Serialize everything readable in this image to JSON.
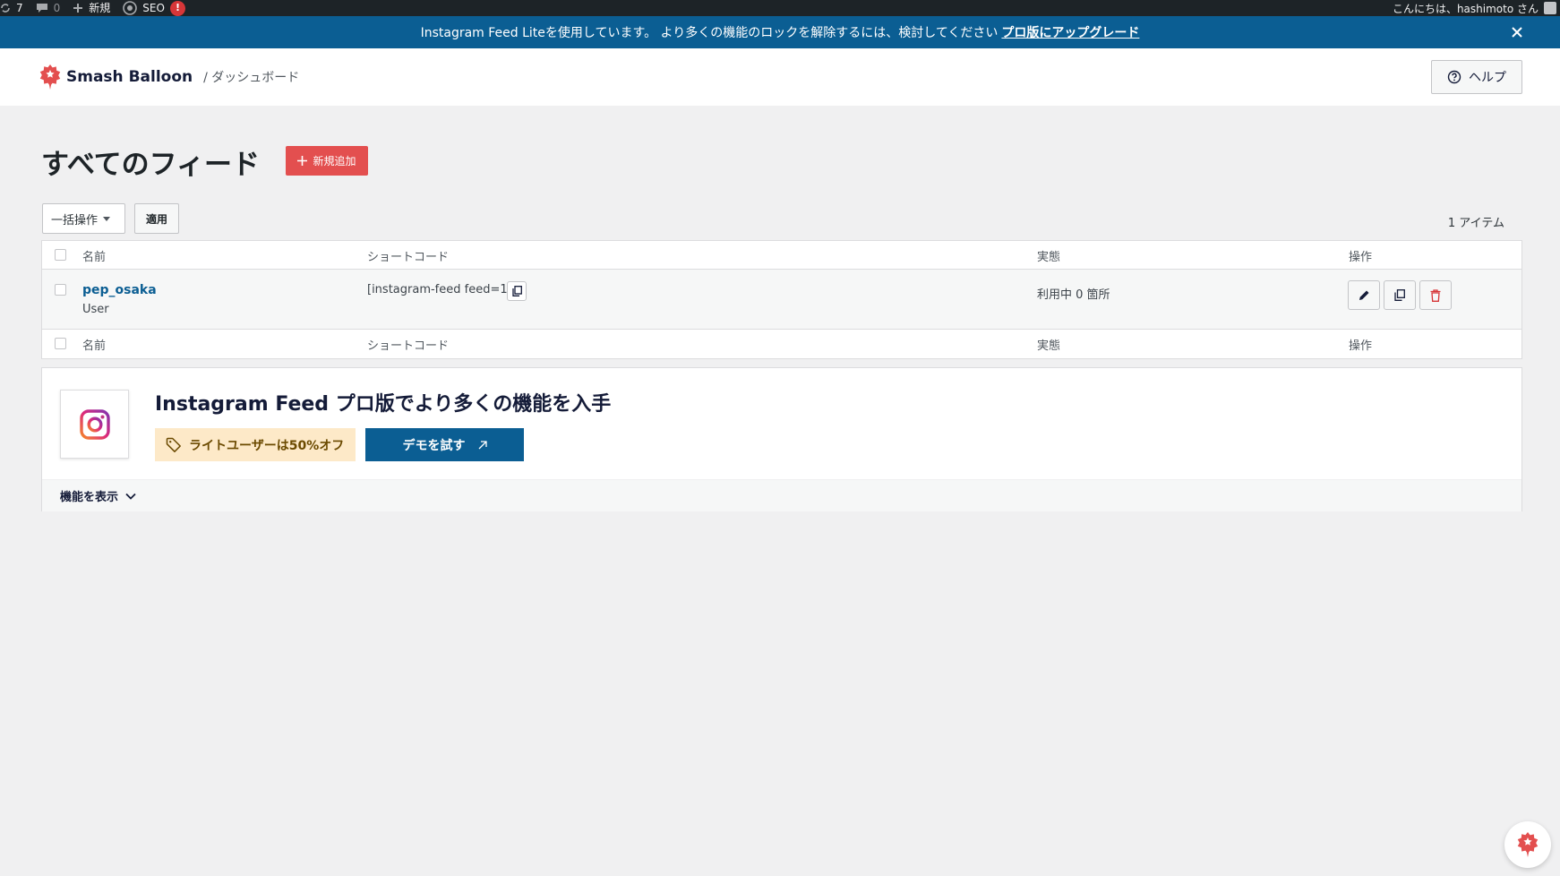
{
  "admin_bar": {
    "updates_count": "7",
    "comments_count": "0",
    "new_label": "新規",
    "seo_label": "SEO",
    "seo_badge": "!",
    "greeting": "こんにちは、hashimoto さん"
  },
  "notice": {
    "text": "Instagram Feed Liteを使用しています。 より多くの機能のロックを解除するには、検討してください",
    "link": "プロ版にアップグレード"
  },
  "header": {
    "brand": "Smash Balloon",
    "breadcrumb": "/ ダッシュボード",
    "help_label": "ヘルプ"
  },
  "page": {
    "title": "すべてのフィード",
    "add_new_label": "新規追加"
  },
  "bulk": {
    "select_label": "一括操作",
    "apply_label": "適用",
    "item_count": "1 アイテム"
  },
  "table": {
    "columns": [
      "名前",
      "ショートコード",
      "実態",
      "操作"
    ],
    "rows": [
      {
        "name": "pep_osaka",
        "type": "User",
        "shortcode": "[instagram-feed feed=1]",
        "status": "利用中 0 箇所"
      }
    ]
  },
  "promo": {
    "title": "Instagram Feed プロ版でより多くの機能を入手",
    "discount_label": "ライトユーザーは50%オフ",
    "demo_label": "デモを試す",
    "features_label": "機能を表示"
  },
  "colors": {
    "admin_bar": "#1d2327",
    "notice": "#0b5e93",
    "accent_red": "#e34f4f",
    "link_blue": "#0b5e93",
    "discount_bg": "#fde9c8",
    "delete_red": "#d63638"
  }
}
